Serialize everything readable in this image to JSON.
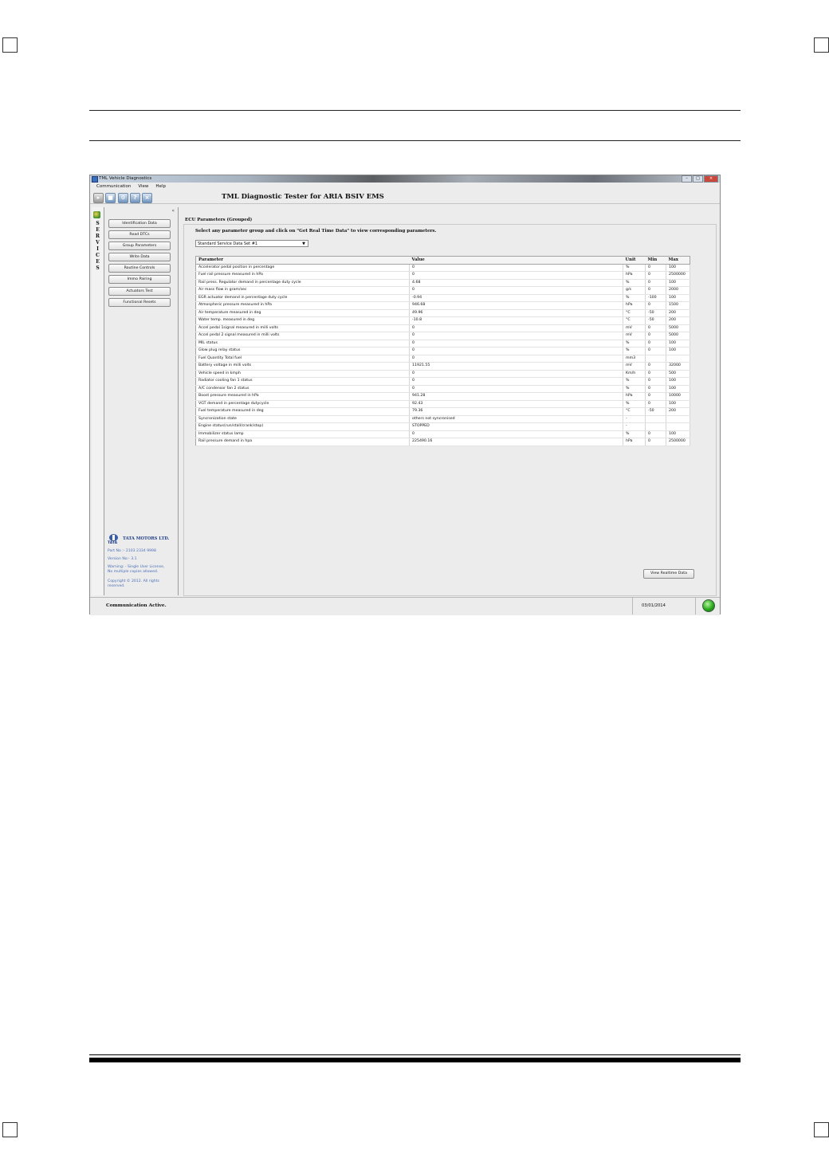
{
  "window": {
    "title": "TML Vehicle Diagnostics"
  },
  "menu": [
    "Communication",
    "View",
    "Help"
  ],
  "toolbar_icons": [
    "play-icon",
    "stop-icon",
    "network-icon",
    "help-icon",
    "close-icon"
  ],
  "app_title": "TML Diagnostic Tester for ARIA BSIV EMS",
  "sidebar": {
    "services_letters": [
      "S",
      "E",
      "R",
      "V",
      "I",
      "C",
      "E",
      "S"
    ],
    "collapse_glyph": "«",
    "items": [
      {
        "label": "Identification Data"
      },
      {
        "label": "Read DTCs"
      },
      {
        "label": "Group Parameters"
      },
      {
        "label": "Write Data"
      },
      {
        "label": "Routine Controls"
      },
      {
        "label": "Immo Pairing"
      },
      {
        "label": "Actuators Test"
      },
      {
        "label": "Functional Resets"
      }
    ],
    "brand": {
      "logo_text": "TATA",
      "name": "TATA MOTORS LTD.",
      "part_no": "Part No :- 2103 2334 9998",
      "version": "Version No:- 3.1",
      "warning1": "Warning: - Single User License,",
      "warning2": "No multiple copies allowed.",
      "copyright1": "Copyright © 2012. All rights",
      "copyright2": "reserved."
    }
  },
  "main": {
    "section_title": "ECU Parameters (Grouped)",
    "instruction": "Select any parameter group and click on \"Get Real Time Data\" to view corresponding parameters.",
    "dropdown_value": "Standard Service Data Set #1",
    "table": {
      "headers": [
        "Parameter",
        "Value",
        "Unit",
        "Min",
        "Max"
      ],
      "rows": [
        [
          "Accelerator pedal position in percentage",
          "0",
          "%",
          "0",
          "100"
        ],
        [
          "Fuel rail pressure measured in hPa",
          "0",
          "hPa",
          "0",
          "2500000"
        ],
        [
          "Rail press. Regulator demand in percentage duty cycle",
          "4.68",
          "%",
          "0",
          "100"
        ],
        [
          "Air mass flow in gram/sec",
          "0",
          "g/s",
          "0",
          "2000"
        ],
        [
          "EGR actuator demand in percentage duty cycle",
          "-0.94",
          "%",
          "-100",
          "100"
        ],
        [
          "Atmospheric pressure measured in hPa",
          "946.68",
          "hPa",
          "0",
          "1500"
        ],
        [
          "Air temperature measured in deg",
          "49.96",
          "°C",
          "-50",
          "200"
        ],
        [
          "Water temp. measured in deg",
          "-10.8",
          "°C",
          "-50",
          "200"
        ],
        [
          "Accel pedal 1signal measured in milli volts",
          "0",
          "mV",
          "0",
          "5000"
        ],
        [
          "Accel pedal 2 signal measured in milli volts",
          "0",
          "mV",
          "0",
          "5000"
        ],
        [
          "MIL status",
          "0",
          "%",
          "0",
          "100"
        ],
        [
          "Glow plug relay status",
          "0",
          "%",
          "0",
          "100"
        ],
        [
          "Fuel Quantity Total fuel",
          "0",
          "mm3",
          "",
          ""
        ],
        [
          "Battery voltage in milli volts",
          "11921.55",
          "mV",
          "0",
          "32000"
        ],
        [
          "Vehicle speed in kmph",
          "0",
          "Km/h",
          "0",
          "500"
        ],
        [
          "Radiator cooling fan 1 status",
          "0",
          "%",
          "0",
          "100"
        ],
        [
          "A/C condensor fan 2 status",
          "0",
          "%",
          "0",
          "100"
        ],
        [
          "Boost pressure measured in hPa",
          "941.28",
          "hPa",
          "0",
          "10000"
        ],
        [
          "VGT demand in percentage dutycycle",
          "92.43",
          "%",
          "0",
          "100"
        ],
        [
          "Fuel temperature measured in deg",
          "79.36",
          "°C",
          "-50",
          "200"
        ],
        [
          "Syncronization state",
          "others not syncronised",
          "-",
          "",
          ""
        ],
        [
          "Engine status(run/stall/crank/stop)",
          "STOPPED",
          "-",
          "",
          ""
        ],
        [
          "Immobilizer status lamp",
          "0",
          "%",
          "0",
          "100"
        ],
        [
          "Rail pressure demand in hpa",
          "225490.16",
          "hPa",
          "0",
          "2500000"
        ]
      ]
    },
    "realtime_button": "View Realtime Data"
  },
  "status": {
    "text": "Communication Active.",
    "date": "03/01/2014",
    "indicator_color": "#29a91d"
  }
}
